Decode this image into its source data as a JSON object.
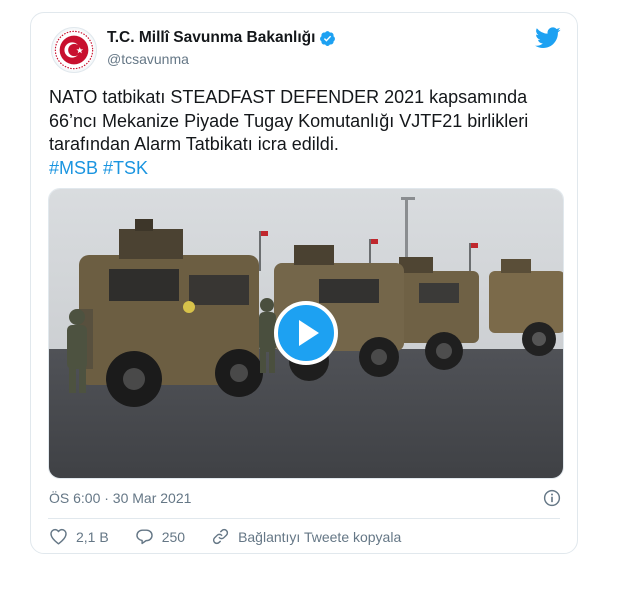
{
  "author": {
    "display_name": "T.C. Millî Savunma Bakanlığı",
    "handle": "@tcsavunma",
    "verified": true
  },
  "tweet": {
    "lines": [
      "NATO tatbikatı STEADFAST DEFENDER 2021 kapsamında",
      "66’ncı Mekanize Piyade Tugay Komutanlığı VJTF21 birlikleri",
      "tarafından Alarm Tatbikatı icra edildi."
    ],
    "hashtags": [
      "#MSB",
      "#TSK"
    ]
  },
  "media": {
    "type": "video",
    "play_icon": "play-icon"
  },
  "timestamp": "ÖS 6:00 · 30 Mar 2021",
  "actions": {
    "likes": "2,1 B",
    "replies": "250",
    "copy_link_label": "Bağlantıyı Tweete kopyala"
  },
  "colors": {
    "accent": "#1da1f2",
    "hashtag": "#1b95e0",
    "muted": "#657786",
    "border": "#e1e8ed"
  }
}
